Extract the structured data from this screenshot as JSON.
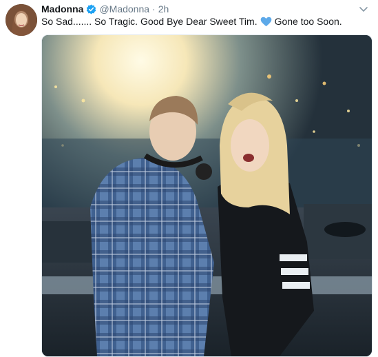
{
  "tweet": {
    "author_name": "Madonna",
    "handle": "@Madonna",
    "separator": "·",
    "time": "2h",
    "text_part1": "So Sad....... So Tragic. Good Bye Dear Sweet Tim.",
    "text_part2": "Gone too Soon.",
    "verified_color": "#1da1f2",
    "heart_color": "#5da9e9"
  },
  "media": {
    "description_icon": "photo",
    "colors": {
      "stage_light": "#fff4c8",
      "crowd": "#2e4656",
      "shirt": "#3d5f8a"
    }
  }
}
